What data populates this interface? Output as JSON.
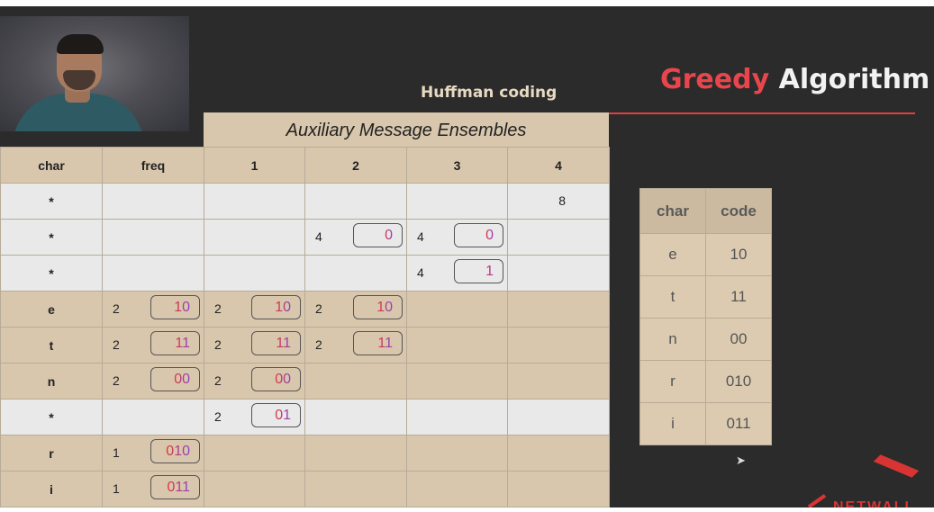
{
  "header": {
    "subtitle": "Huffman coding",
    "title_word1": "Greedy",
    "title_word2": "Algorithm"
  },
  "band_title": "Auxiliary Message Ensembles",
  "table": {
    "columns": [
      "char",
      "freq",
      "1",
      "2",
      "3",
      "4"
    ],
    "rows": [
      {
        "char": "*",
        "style": "grey",
        "cells": [
          null,
          null,
          null,
          null,
          {
            "num": "8"
          }
        ]
      },
      {
        "char": "*",
        "style": "grey",
        "cells": [
          null,
          null,
          {
            "num": "4",
            "code": "0"
          },
          {
            "num": "4",
            "code": "0"
          },
          null
        ]
      },
      {
        "char": "*",
        "style": "grey",
        "cells": [
          null,
          null,
          null,
          {
            "num": "4",
            "code": "1"
          },
          null
        ]
      },
      {
        "char": "e",
        "style": "tan",
        "cells": [
          {
            "num": "2",
            "code": "10"
          },
          {
            "num": "2",
            "code": "10"
          },
          {
            "num": "2",
            "code": "10"
          },
          null,
          null
        ]
      },
      {
        "char": "t",
        "style": "tan",
        "cells": [
          {
            "num": "2",
            "code": "11"
          },
          {
            "num": "2",
            "code": "11"
          },
          {
            "num": "2",
            "code": "11"
          },
          null,
          null
        ]
      },
      {
        "char": "n",
        "style": "tan",
        "cells": [
          {
            "num": "2",
            "code": "00"
          },
          {
            "num": "2",
            "code": "00"
          },
          null,
          null,
          null
        ]
      },
      {
        "char": "*",
        "style": "grey",
        "cells": [
          null,
          {
            "num": "2",
            "code": "01"
          },
          null,
          null,
          null
        ]
      },
      {
        "char": "r",
        "style": "tan",
        "cells": [
          {
            "num": "1",
            "code": "010"
          },
          null,
          null,
          null,
          null
        ]
      },
      {
        "char": "i",
        "style": "tan",
        "cells": [
          {
            "num": "1",
            "code": "011"
          },
          null,
          null,
          null,
          null
        ]
      }
    ]
  },
  "code_table": {
    "headers": [
      "char",
      "code"
    ],
    "rows": [
      [
        "e",
        "10"
      ],
      [
        "t",
        "11"
      ],
      [
        "n",
        "00"
      ],
      [
        "r",
        "010"
      ],
      [
        "i",
        "011"
      ]
    ]
  },
  "logo_text": "NETWALL",
  "icons": {
    "cursor": "mouse-pointer-icon"
  },
  "colors": {
    "accent": "#e8464c",
    "background": "#2b2b2b",
    "tan": "#d8c7ad",
    "grey": "#e9e9e9"
  }
}
